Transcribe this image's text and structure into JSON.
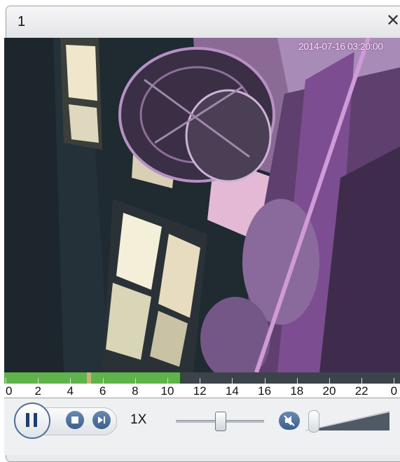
{
  "window": {
    "title": "1",
    "close_glyph": "✕"
  },
  "video": {
    "osd_timestamp": "2014-07-16 03:20:00"
  },
  "timeline": {
    "played_fraction": 0.44,
    "marker_fraction": 0.205,
    "scale_labels": [
      "0",
      "2",
      "4",
      "6",
      "8",
      "10",
      "12",
      "14",
      "16",
      "18",
      "20",
      "22",
      "0"
    ]
  },
  "controls": {
    "speed_label": "1X",
    "speed_slider_fraction": 0.5,
    "volume_fraction": 0.0,
    "icons": {
      "pause": "pause-icon",
      "stop": "stop-icon",
      "step": "step-forward-icon",
      "volume": "speaker-icon"
    }
  },
  "colors": {
    "played": "#5fb34a",
    "unplayed": "#3c434a",
    "accent": "#3b5f8e"
  }
}
